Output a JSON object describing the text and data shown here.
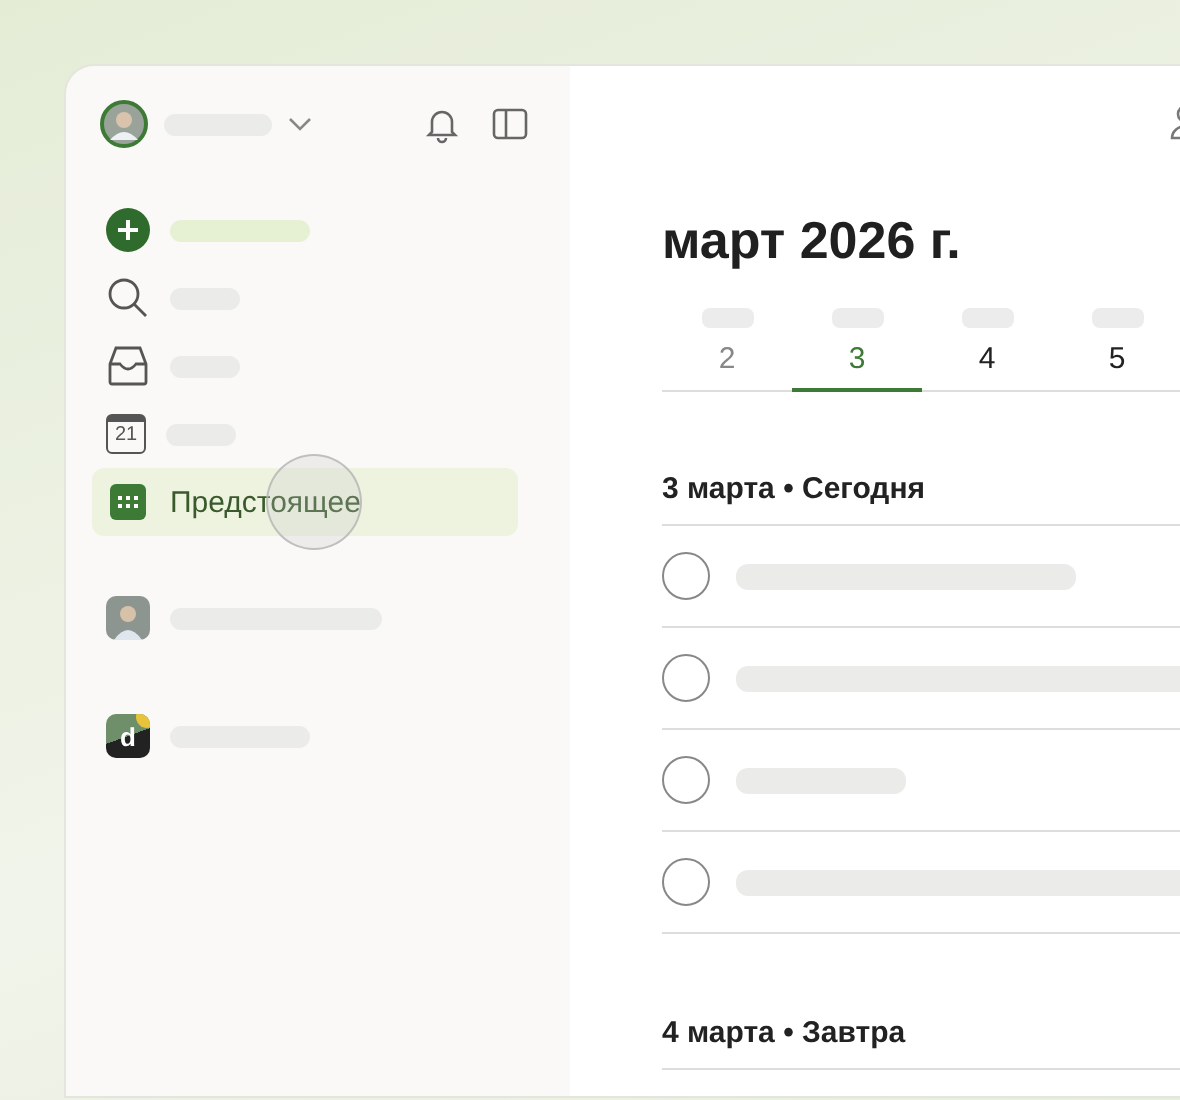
{
  "sidebar": {
    "nav": [
      {
        "kind": "add",
        "selected": false
      },
      {
        "kind": "search",
        "selected": false
      },
      {
        "kind": "inbox",
        "selected": false
      },
      {
        "kind": "today",
        "icon_text": "21",
        "selected": false
      },
      {
        "kind": "upcoming",
        "label": "Предстоящее",
        "selected": true
      }
    ],
    "projects": [
      {
        "kind": "avatar"
      },
      {
        "kind": "logo",
        "letter": "d"
      }
    ]
  },
  "main": {
    "title": "март 2026 г.",
    "days": [
      {
        "number": "2",
        "past": true,
        "selected": false
      },
      {
        "number": "3",
        "past": false,
        "selected": true
      },
      {
        "number": "4",
        "past": false,
        "selected": false
      },
      {
        "number": "5",
        "past": false,
        "selected": false
      }
    ],
    "sections": [
      {
        "title": "3 марта • Сегодня",
        "tasks": [
          {
            "checked": false
          },
          {
            "checked": false
          },
          {
            "checked": false
          },
          {
            "checked": false
          }
        ]
      },
      {
        "title": "4 марта • Завтра"
      }
    ]
  }
}
